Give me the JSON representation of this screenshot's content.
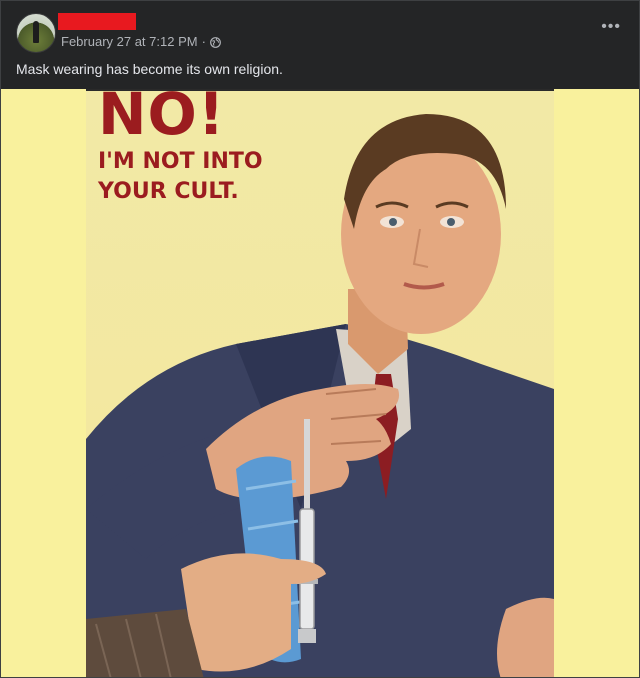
{
  "post": {
    "timestamp": "February 27 at 7:12 PM",
    "separator": "·",
    "privacy_icon": "globe-icon",
    "more_icon": "more-horizontal-icon",
    "more_glyph": "•••",
    "caption": "Mask wearing has become its own religion."
  },
  "poster": {
    "headline": "NO!",
    "subline_1": "I'M NOT INTO",
    "subline_2": "YOUR CULT."
  },
  "colors": {
    "background": "#242526",
    "text_primary": "#e4e6eb",
    "text_secondary": "#b0b3b8",
    "redaction": "#e8191f",
    "poster_red": "#9b1c1f",
    "poster_background": "#f9f19d"
  }
}
